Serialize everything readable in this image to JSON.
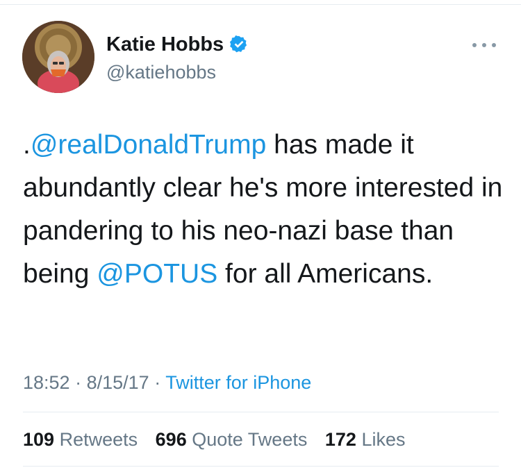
{
  "author": {
    "name": "Katie Hobbs",
    "handle": "@katiehobbs",
    "verified": true
  },
  "tweet": {
    "prefix": ".",
    "mention_1": "@realDonaldTrump",
    "text_1": " has made it abundantly clear he's more interested in pandering to his neo-nazi base than being ",
    "mention_2": "@POTUS",
    "text_2": " for all Americans."
  },
  "meta": {
    "time": "18:52",
    "separator": "·",
    "date": "8/15/17",
    "source": "Twitter for iPhone"
  },
  "stats": {
    "retweets_count": "109",
    "retweets_label": "Retweets",
    "quotes_count": "696",
    "quotes_label": "Quote Tweets",
    "likes_count": "172",
    "likes_label": "Likes"
  },
  "colors": {
    "link": "#1b95e0",
    "secondary_text": "#657786",
    "primary_text": "#14171a",
    "verified": "#1da1f2"
  },
  "icons": [
    "verified-badge-icon",
    "more-options-icon"
  ]
}
